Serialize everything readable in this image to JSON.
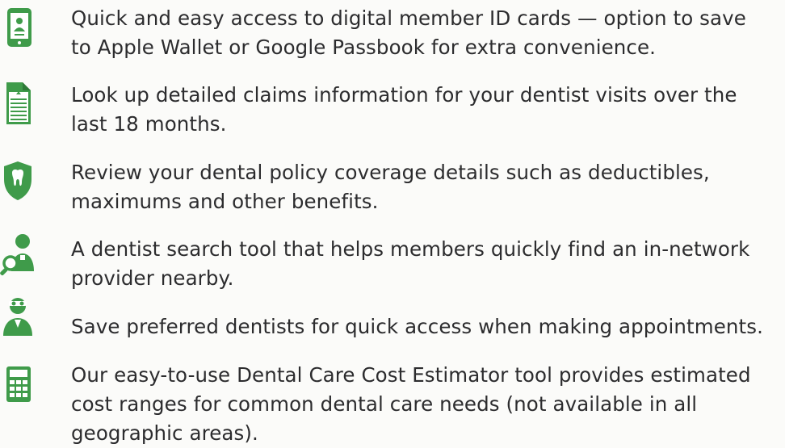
{
  "accent_color": "#3f9b4a",
  "features": [
    {
      "icon": "mobile-id-card-icon",
      "text": "Quick and easy access to digital member ID cards — option to save\nto Apple Wallet or Google Passbook for extra convenience."
    },
    {
      "icon": "claims-document-icon",
      "text": "Look up detailed claims information for your dentist visits over the\nlast 18 months."
    },
    {
      "icon": "tooth-shield-icon",
      "text": "Review your dental policy coverage details such as deductibles,\nmaximums and other benefits."
    },
    {
      "icon": "dentist-search-icon",
      "text": "A dentist search tool that helps members quickly find an in-network\nprovider nearby."
    },
    {
      "icon": "dentist-person-icon",
      "text": "Save preferred dentists for quick access when making appointments."
    },
    {
      "icon": "calculator-icon",
      "text": "Our easy-to-use Dental Care Cost Estimator tool provides estimated\ncost ranges for common dental care needs (not available in all\ngeographic areas)."
    }
  ]
}
